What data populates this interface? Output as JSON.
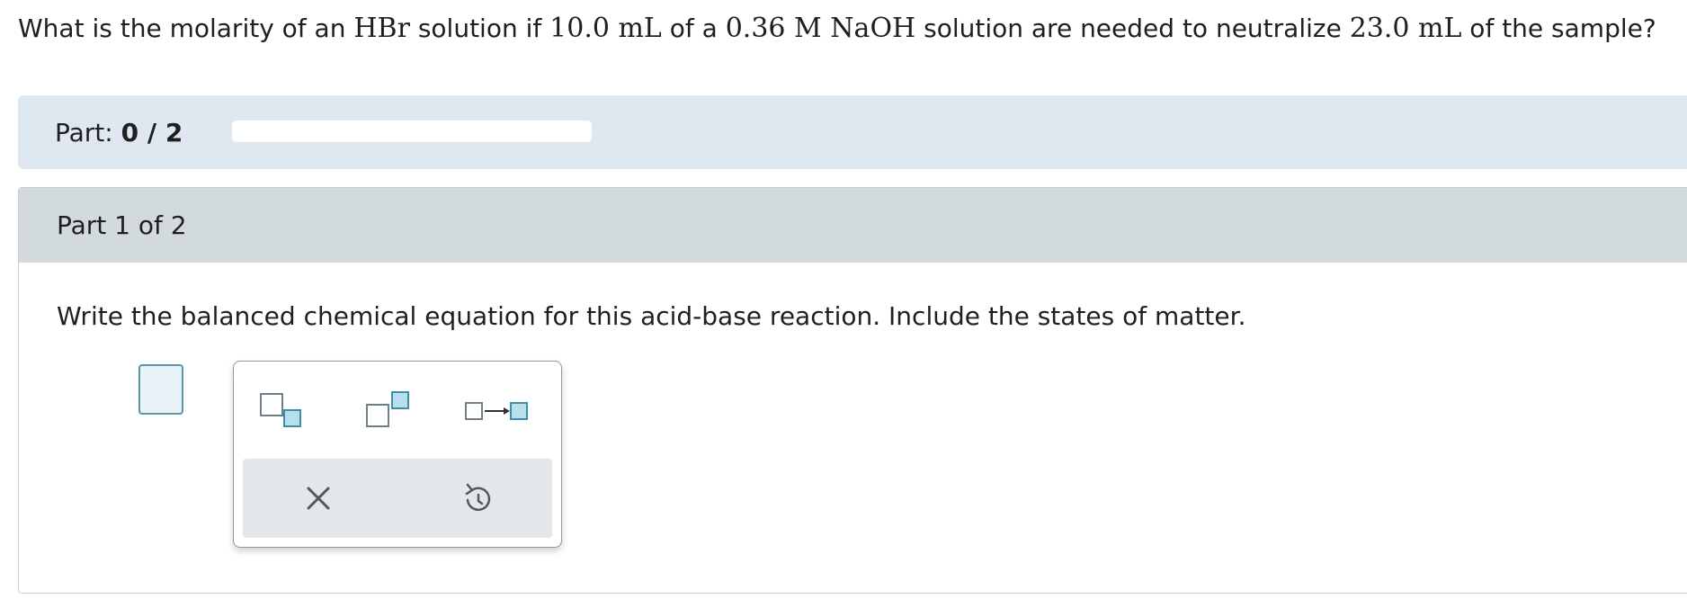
{
  "question": {
    "t1": "What is the molarity of an ",
    "m1": "HBr",
    "t2": " solution if ",
    "m2": "10.0 mL",
    "t3": " of a ",
    "m3": "0.36 M NaOH",
    "t4": " solution are needed to neutralize ",
    "m4": "23.0 mL",
    "t5": " of the sample?"
  },
  "progress": {
    "label": "Part: ",
    "value": "0 / 2",
    "fraction": 0
  },
  "part": {
    "header": "Part 1 of 2",
    "instruction": "Write the balanced chemical equation for this acid-base reaction. Include the states of matter."
  },
  "palette": {
    "tools": [
      "subscript-icon",
      "superscript-icon",
      "reaction-arrow-icon"
    ],
    "actions": [
      "clear-icon",
      "undo-icon"
    ]
  },
  "colors": {
    "accent": "#5d95aa",
    "box_fill": "#e8f3f7",
    "progress_bg": "#dfe8f0",
    "header_bg": "#d3dade"
  }
}
